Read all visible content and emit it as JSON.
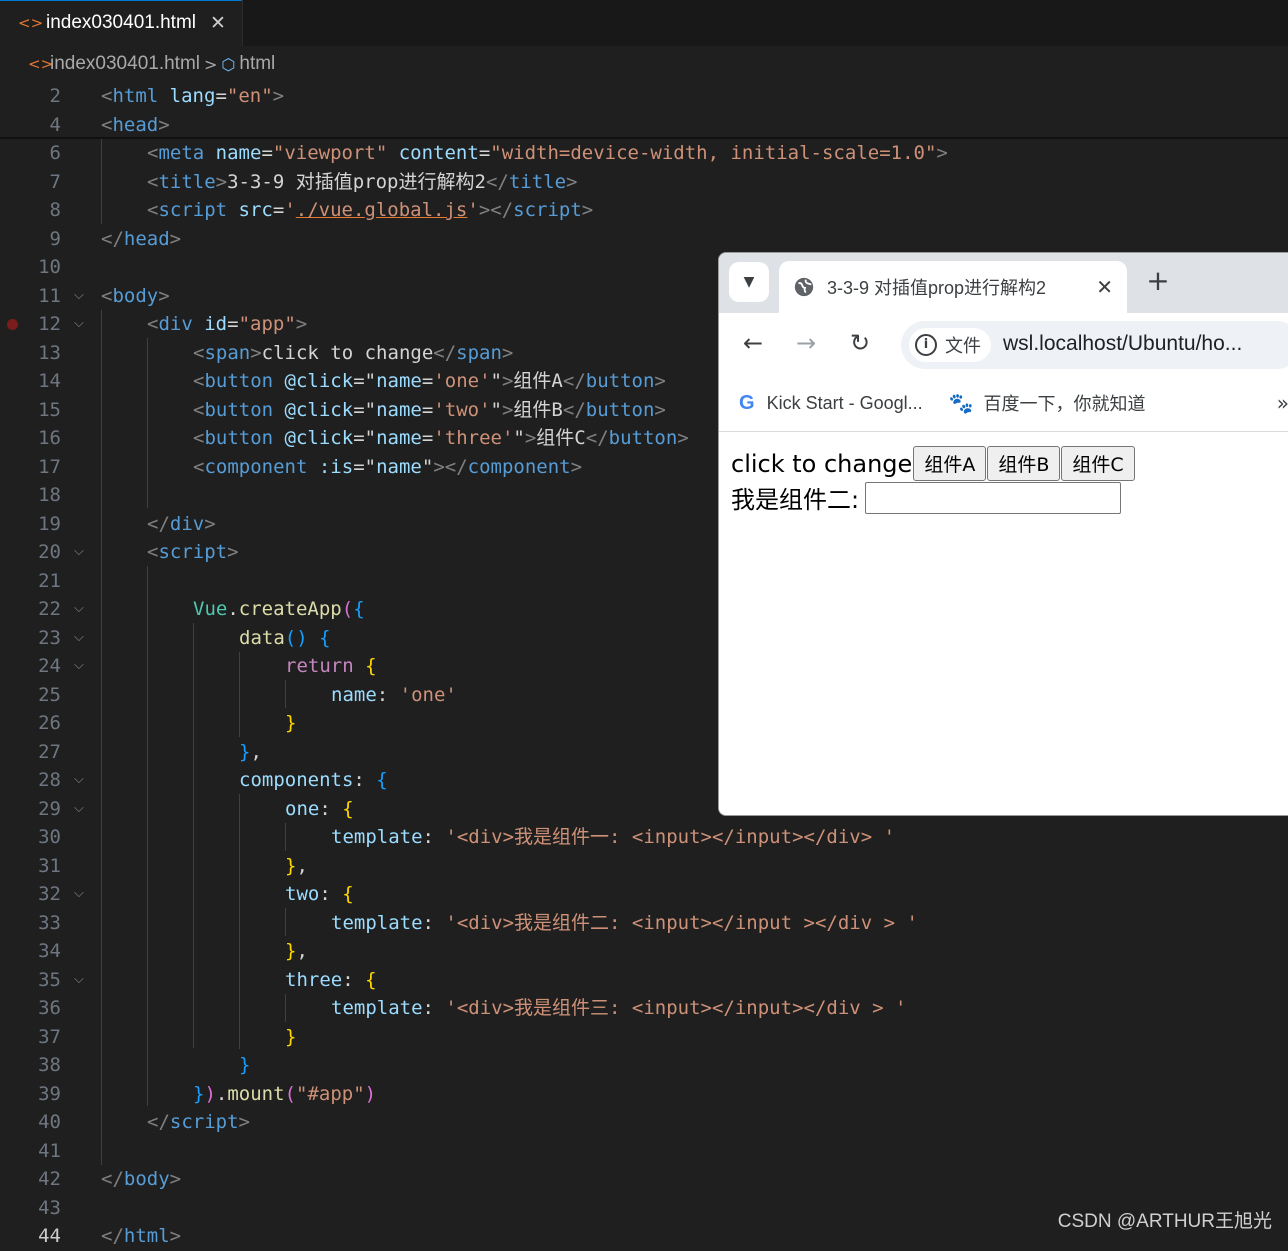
{
  "editor": {
    "tab_icon": "html-file-icon",
    "tab_title": "index030401.html",
    "tab_close": "✕",
    "breadcrumb_file": "index030401.html",
    "breadcrumb_separator": ">",
    "breadcrumb_element": "html",
    "current_line": "44",
    "colors": {
      "background": "#1f1f1f",
      "tag": "#569cd6",
      "attribute": "#9cdcfe",
      "string": "#ce9178",
      "keyword": "#c586c0",
      "function": "#dcdcaa"
    },
    "lines": [
      {
        "n": "2",
        "indent": 0,
        "fold": false,
        "tokens": [
          [
            "<",
            "br"
          ],
          [
            "html",
            "tag"
          ],
          [
            " ",
            "txt"
          ],
          [
            "lang",
            "attr"
          ],
          [
            "=",
            "txt"
          ],
          [
            "\"en\"",
            "str"
          ],
          [
            ">",
            "br"
          ]
        ]
      },
      {
        "n": "4",
        "indent": 0,
        "fold": false,
        "tokens": [
          [
            "<",
            "br"
          ],
          [
            "head",
            "tag"
          ],
          [
            ">",
            "br"
          ]
        ]
      },
      {
        "n": "6",
        "indent": 1,
        "fold": false,
        "tokens": [
          [
            "<",
            "br"
          ],
          [
            "meta",
            "tag"
          ],
          [
            " ",
            "txt"
          ],
          [
            "name",
            "attr"
          ],
          [
            "=",
            "txt"
          ],
          [
            "\"viewport\"",
            "str"
          ],
          [
            " ",
            "txt"
          ],
          [
            "content",
            "attr"
          ],
          [
            "=",
            "txt"
          ],
          [
            "\"width=device-width, initial-scale=1.0\"",
            "str"
          ],
          [
            ">",
            "br"
          ]
        ]
      },
      {
        "n": "7",
        "indent": 1,
        "fold": false,
        "tokens": [
          [
            "<",
            "br"
          ],
          [
            "title",
            "tag"
          ],
          [
            ">",
            "br"
          ],
          [
            "3-3-9 对插值prop进行解构2",
            "txt"
          ],
          [
            "</",
            "br"
          ],
          [
            "title",
            "tag"
          ],
          [
            ">",
            "br"
          ]
        ]
      },
      {
        "n": "8",
        "indent": 1,
        "fold": false,
        "tokens": [
          [
            "<",
            "br"
          ],
          [
            "script",
            "tag"
          ],
          [
            " ",
            "txt"
          ],
          [
            "src",
            "attr"
          ],
          [
            "=",
            "txt"
          ],
          [
            "'",
            "str"
          ],
          [
            "./vue.global.js",
            "stru"
          ],
          [
            "'",
            "str"
          ],
          [
            "></",
            "br"
          ],
          [
            "script",
            "tag"
          ],
          [
            ">",
            "br"
          ]
        ]
      },
      {
        "n": "9",
        "indent": 0,
        "fold": false,
        "tokens": [
          [
            "</",
            "br"
          ],
          [
            "head",
            "tag"
          ],
          [
            ">",
            "br"
          ]
        ]
      },
      {
        "n": "10",
        "indent": 0,
        "fold": false,
        "tokens": []
      },
      {
        "n": "11",
        "indent": 0,
        "fold": true,
        "tokens": [
          [
            "<",
            "br"
          ],
          [
            "body",
            "tag"
          ],
          [
            ">",
            "br"
          ]
        ]
      },
      {
        "n": "12",
        "indent": 1,
        "fold": true,
        "bp": true,
        "tokens": [
          [
            "<",
            "br"
          ],
          [
            "div",
            "tag"
          ],
          [
            " ",
            "txt"
          ],
          [
            "id",
            "attr"
          ],
          [
            "=",
            "txt"
          ],
          [
            "\"app\"",
            "str"
          ],
          [
            ">",
            "br"
          ]
        ]
      },
      {
        "n": "13",
        "indent": 2,
        "fold": false,
        "tokens": [
          [
            "<",
            "br"
          ],
          [
            "span",
            "tag"
          ],
          [
            ">",
            "br"
          ],
          [
            "click to change",
            "txt"
          ],
          [
            "</",
            "br"
          ],
          [
            "span",
            "tag"
          ],
          [
            ">",
            "br"
          ]
        ]
      },
      {
        "n": "14",
        "indent": 2,
        "fold": false,
        "tokens": [
          [
            "<",
            "br"
          ],
          [
            "button",
            "tag"
          ],
          [
            " ",
            "txt"
          ],
          [
            "@click",
            "attr"
          ],
          [
            "=",
            "txt"
          ],
          [
            "\"",
            "txt"
          ],
          [
            "name",
            "var"
          ],
          [
            "=",
            "txt"
          ],
          [
            "'one'",
            "str"
          ],
          [
            "\"",
            "txt"
          ],
          [
            ">",
            "br"
          ],
          [
            "组件A",
            "txt"
          ],
          [
            "</",
            "br"
          ],
          [
            "button",
            "tag"
          ],
          [
            ">",
            "br"
          ]
        ]
      },
      {
        "n": "15",
        "indent": 2,
        "fold": false,
        "tokens": [
          [
            "<",
            "br"
          ],
          [
            "button",
            "tag"
          ],
          [
            " ",
            "txt"
          ],
          [
            "@click",
            "attr"
          ],
          [
            "=",
            "txt"
          ],
          [
            "\"",
            "txt"
          ],
          [
            "name",
            "var"
          ],
          [
            "=",
            "txt"
          ],
          [
            "'two'",
            "str"
          ],
          [
            "\"",
            "txt"
          ],
          [
            ">",
            "br"
          ],
          [
            "组件B",
            "txt"
          ],
          [
            "</",
            "br"
          ],
          [
            "button",
            "tag"
          ],
          [
            ">",
            "br"
          ]
        ]
      },
      {
        "n": "16",
        "indent": 2,
        "fold": false,
        "tokens": [
          [
            "<",
            "br"
          ],
          [
            "button",
            "tag"
          ],
          [
            " ",
            "txt"
          ],
          [
            "@click",
            "attr"
          ],
          [
            "=",
            "txt"
          ],
          [
            "\"",
            "txt"
          ],
          [
            "name",
            "var"
          ],
          [
            "=",
            "txt"
          ],
          [
            "'three'",
            "str"
          ],
          [
            "\"",
            "txt"
          ],
          [
            ">",
            "br"
          ],
          [
            "组件C",
            "txt"
          ],
          [
            "</",
            "br"
          ],
          [
            "button",
            "tag"
          ],
          [
            ">",
            "br"
          ]
        ]
      },
      {
        "n": "17",
        "indent": 2,
        "fold": false,
        "tokens": [
          [
            "<",
            "br"
          ],
          [
            "component",
            "tag"
          ],
          [
            " ",
            "txt"
          ],
          [
            ":is",
            "attr"
          ],
          [
            "=",
            "txt"
          ],
          [
            "\"",
            "txt"
          ],
          [
            "name",
            "var"
          ],
          [
            "\"",
            "txt"
          ],
          [
            "></",
            "br"
          ],
          [
            "component",
            "tag"
          ],
          [
            ">",
            "br"
          ]
        ]
      },
      {
        "n": "18",
        "indent": 0,
        "fold": false,
        "tokens": []
      },
      {
        "n": "19",
        "indent": 1,
        "fold": false,
        "tokens": [
          [
            "</",
            "br"
          ],
          [
            "div",
            "tag"
          ],
          [
            ">",
            "br"
          ]
        ]
      },
      {
        "n": "20",
        "indent": 1,
        "fold": true,
        "tokens": [
          [
            "<",
            "br"
          ],
          [
            "script",
            "tag"
          ],
          [
            ">",
            "br"
          ]
        ]
      },
      {
        "n": "21",
        "indent": 0,
        "fold": false,
        "tokens": []
      },
      {
        "n": "22",
        "indent": 2,
        "fold": true,
        "tokens": [
          [
            "Vue",
            "cls"
          ],
          [
            ".",
            "txt"
          ],
          [
            "createApp",
            "fn"
          ],
          [
            "(",
            "p"
          ],
          [
            "{",
            "b"
          ]
        ]
      },
      {
        "n": "23",
        "indent": 3,
        "fold": true,
        "tokens": [
          [
            "data",
            "fn"
          ],
          [
            "()",
            "b"
          ],
          [
            " ",
            "txt"
          ],
          [
            "{",
            "b"
          ]
        ]
      },
      {
        "n": "24",
        "indent": 4,
        "fold": true,
        "tokens": [
          [
            "return",
            "kw"
          ],
          [
            " ",
            "txt"
          ],
          [
            "{",
            "y"
          ]
        ]
      },
      {
        "n": "25",
        "indent": 5,
        "fold": false,
        "tokens": [
          [
            "name",
            "var"
          ],
          [
            ": ",
            "txt"
          ],
          [
            "'one'",
            "str"
          ]
        ]
      },
      {
        "n": "26",
        "indent": 4,
        "fold": false,
        "tokens": [
          [
            "}",
            "y"
          ]
        ]
      },
      {
        "n": "27",
        "indent": 3,
        "fold": false,
        "tokens": [
          [
            "}",
            "b"
          ],
          [
            ",",
            "txt"
          ]
        ]
      },
      {
        "n": "28",
        "indent": 3,
        "fold": true,
        "tokens": [
          [
            "components",
            "var"
          ],
          [
            ": ",
            "txt"
          ],
          [
            "{",
            "b"
          ]
        ]
      },
      {
        "n": "29",
        "indent": 4,
        "fold": true,
        "tokens": [
          [
            "one",
            "var"
          ],
          [
            ": ",
            "txt"
          ],
          [
            "{",
            "y"
          ]
        ]
      },
      {
        "n": "30",
        "indent": 5,
        "fold": false,
        "tokens": [
          [
            "template",
            "var"
          ],
          [
            ": ",
            "txt"
          ],
          [
            "'<div>我是组件一: <input></input></div> '",
            "str"
          ]
        ]
      },
      {
        "n": "31",
        "indent": 4,
        "fold": false,
        "tokens": [
          [
            "}",
            "y"
          ],
          [
            ",",
            "txt"
          ]
        ]
      },
      {
        "n": "32",
        "indent": 4,
        "fold": true,
        "tokens": [
          [
            "two",
            "var"
          ],
          [
            ": ",
            "txt"
          ],
          [
            "{",
            "y"
          ]
        ]
      },
      {
        "n": "33",
        "indent": 5,
        "fold": false,
        "tokens": [
          [
            "template",
            "var"
          ],
          [
            ": ",
            "txt"
          ],
          [
            "'<div>我是组件二: <input></input ></div > '",
            "str"
          ]
        ]
      },
      {
        "n": "34",
        "indent": 4,
        "fold": false,
        "tokens": [
          [
            "}",
            "y"
          ],
          [
            ",",
            "txt"
          ]
        ]
      },
      {
        "n": "35",
        "indent": 4,
        "fold": true,
        "tokens": [
          [
            "three",
            "var"
          ],
          [
            ": ",
            "txt"
          ],
          [
            "{",
            "y"
          ]
        ]
      },
      {
        "n": "36",
        "indent": 5,
        "fold": false,
        "tokens": [
          [
            "template",
            "var"
          ],
          [
            ": ",
            "txt"
          ],
          [
            "'<div>我是组件三: <input></input></div > '",
            "str"
          ]
        ]
      },
      {
        "n": "37",
        "indent": 4,
        "fold": false,
        "tokens": [
          [
            "}",
            "y"
          ]
        ]
      },
      {
        "n": "38",
        "indent": 3,
        "fold": false,
        "tokens": [
          [
            "}",
            "b"
          ]
        ]
      },
      {
        "n": "39",
        "indent": 2,
        "fold": false,
        "tokens": [
          [
            "}",
            "b"
          ],
          [
            ")",
            "p"
          ],
          [
            ".",
            "txt"
          ],
          [
            "mount",
            "fn"
          ],
          [
            "(",
            "p"
          ],
          [
            "\"#app\"",
            "str"
          ],
          [
            ")",
            "p"
          ]
        ]
      },
      {
        "n": "40",
        "indent": 1,
        "fold": false,
        "tokens": [
          [
            "</",
            "br"
          ],
          [
            "script",
            "tag"
          ],
          [
            ">",
            "br"
          ]
        ]
      },
      {
        "n": "41",
        "indent": 0,
        "fold": false,
        "tokens": []
      },
      {
        "n": "42",
        "indent": 0,
        "fold": false,
        "tokens": [
          [
            "</",
            "br"
          ],
          [
            "body",
            "tag"
          ],
          [
            ">",
            "br"
          ]
        ]
      },
      {
        "n": "43",
        "indent": 0,
        "fold": false,
        "tokens": []
      },
      {
        "n": "44",
        "indent": 0,
        "fold": false,
        "tokens": [
          [
            "</",
            "br"
          ],
          [
            "html",
            "tag"
          ],
          [
            ">",
            "br"
          ]
        ]
      }
    ]
  },
  "browser": {
    "tab_title": "3-3-9 对插值prop进行解构2",
    "tab_close": "✕",
    "new_tab": "+",
    "menu_icon": "chevron-down-icon",
    "back": "←",
    "forward": "→",
    "reload": "↻",
    "security_chip": "文件",
    "url": "wsl.localhost/Ubuntu/ho...",
    "bookmarks": [
      {
        "icon": "G",
        "label": "Kick Start - Googl..."
      },
      {
        "icon": "🐾",
        "label": "百度一下，你就知道"
      }
    ],
    "bookmarks_more": "»",
    "page": {
      "span_text": "click to change",
      "buttons": [
        "组件A",
        "组件B",
        "组件C"
      ],
      "component_label": "我是组件二:",
      "input_value": ""
    }
  },
  "watermark": "CSDN @ARTHUR王旭光"
}
